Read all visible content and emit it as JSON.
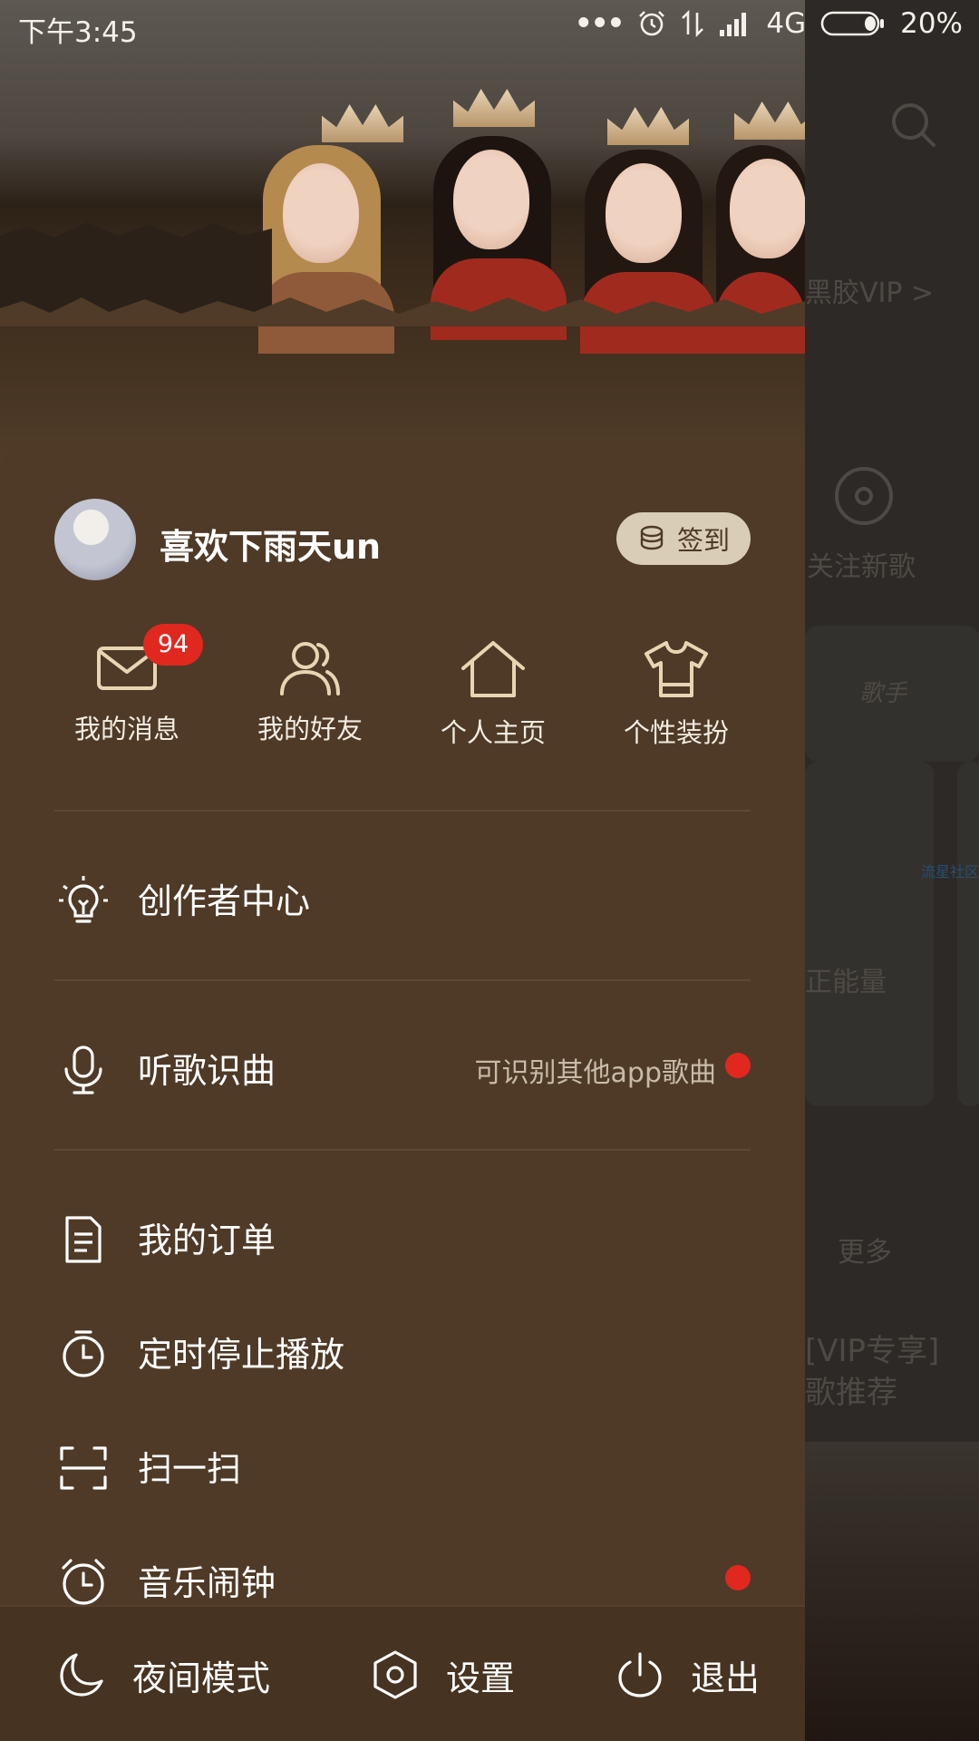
{
  "status_bar": {
    "time": "下午3:45",
    "network": "4G",
    "battery": "20%"
  },
  "background_page": {
    "vip_link": "黑胶VIP >",
    "new_songs": "关注新歌",
    "singer_link": "歌手",
    "community_tag": "流星社区",
    "energy": "正能量",
    "more": "更多",
    "vip_exclusive": "[VIP专享]",
    "recommend": "歌推荐"
  },
  "drawer": {
    "username": "喜欢下雨天un",
    "checkin_label": "签到",
    "quick_actions": [
      {
        "label": "我的消息",
        "icon": "mail-icon",
        "badge": "94"
      },
      {
        "label": "我的好友",
        "icon": "friends-icon"
      },
      {
        "label": "个人主页",
        "icon": "home-icon"
      },
      {
        "label": "个性装扮",
        "icon": "shirt-icon"
      }
    ],
    "menu": [
      {
        "label": "创作者中心",
        "icon": "lightbulb-icon"
      },
      {
        "label": "听歌识曲",
        "icon": "microphone-icon",
        "hint": "可识别其他app歌曲",
        "dot": true
      },
      {
        "label": "我的订单",
        "icon": "document-icon"
      },
      {
        "label": "定时停止播放",
        "icon": "timer-icon"
      },
      {
        "label": "扫一扫",
        "icon": "scan-icon"
      },
      {
        "label": "音乐闹钟",
        "icon": "alarm-icon",
        "dot": true
      }
    ],
    "bottom": {
      "night_mode": "夜间模式",
      "settings": "设置",
      "logout": "退出"
    }
  },
  "colors": {
    "drawer_bg": "#4e3a27",
    "accent_red": "#e0281f",
    "icon_gold": "#e9d5b3",
    "checkin_bg": "#d9cdb5"
  }
}
